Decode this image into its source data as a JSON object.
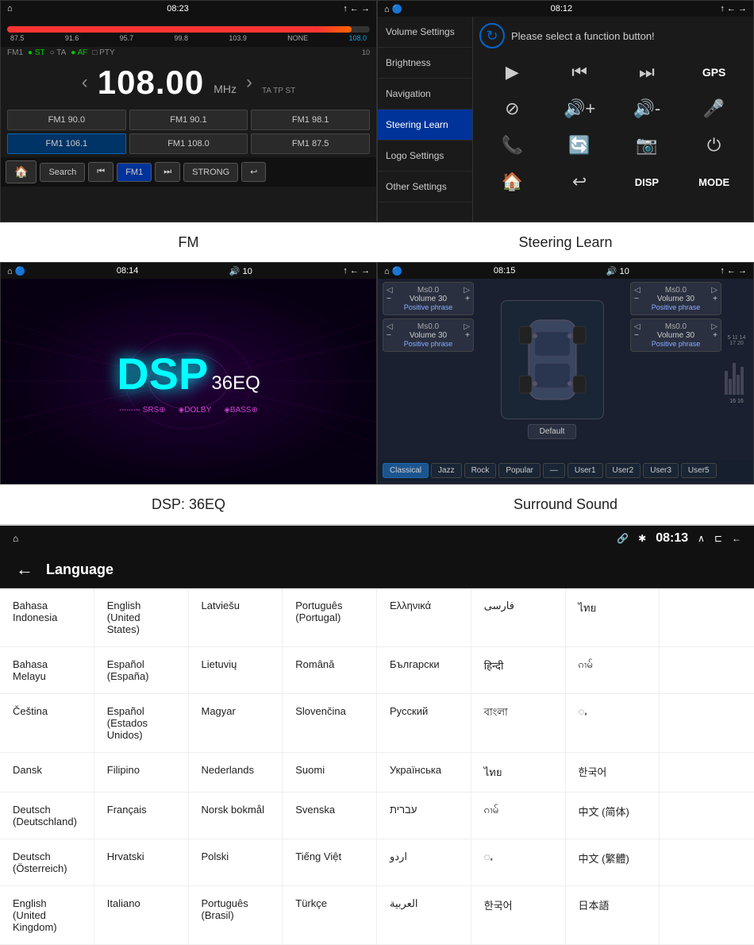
{
  "fm": {
    "statusbar": {
      "left": "⌂",
      "time": "08:23",
      "right": "↑ ← →"
    },
    "freq_markers": [
      "87.5",
      "91.6",
      "95.7",
      "99.8",
      "103.9",
      "NONE",
      "108.0"
    ],
    "freq_labels": [
      "FM1",
      "ST",
      "TA",
      "AF",
      "PTY"
    ],
    "freq_big": "108.00",
    "freq_unit": "MHz",
    "freq_tags": "TA  TP  ST",
    "presets": [
      "FM1 90.0",
      "FM1 90.1",
      "FM1 98.1",
      "FM1 106.1",
      "FM1 108.0",
      "FM1 87.5"
    ],
    "bottom_btns": [
      "🏠",
      "Search",
      "⏮",
      "FM1",
      "⏭",
      "STRONG",
      "↩"
    ],
    "caption": "FM"
  },
  "steering": {
    "statusbar": {
      "left": "⌂  🔵  🔷",
      "time": "08:12",
      "right": "↑ ← →"
    },
    "msg": "Please select a function button!",
    "menu_items": [
      "Volume Settings",
      "Brightness",
      "Navigation",
      "Steering Learn",
      "Logo Settings",
      "Other Settings"
    ],
    "active_menu": "Steering Learn",
    "icons": [
      "▶",
      "⏮",
      "⏭",
      "GPS",
      "⊘",
      "🔊+",
      "🔊-",
      "🎤",
      "📞",
      "🔄",
      "📷",
      "⏻",
      "🏠",
      "↩",
      "DISP",
      "MODE"
    ],
    "caption": "Steering Learn"
  },
  "dsp": {
    "statusbar": {
      "left": "⌂  🔵  🔷",
      "time": "08:14",
      "vol": "🔊  10",
      "right": "↑ ← →"
    },
    "title": "DSP",
    "subtitle": "36EQ",
    "tags": [
      "𝌀𝌀𝌀 SRS⊕",
      "◈DOLBY",
      "◈BASS⊕"
    ],
    "caption": "DSP: 36EQ"
  },
  "surround": {
    "statusbar": {
      "left": "⌂  🔵  🔷",
      "time": "08:15",
      "vol": "🔊  10",
      "right": "↑ ← →"
    },
    "blocks_left": [
      {
        "label": "Ms0.0",
        "vol": "Volume 30",
        "phrase": "Positive phrase"
      },
      {
        "label": "Ms0.0",
        "vol": "Volume 30",
        "phrase": "Positive phrase"
      }
    ],
    "blocks_right": [
      {
        "label": "Ms0.0",
        "vol": "Volume 30",
        "phrase": "Positive phrase"
      },
      {
        "label": "Ms0.0",
        "vol": "Volume 30",
        "phrase": "Positive phrase"
      }
    ],
    "default_btn": "Default",
    "eq_tabs": [
      "Classical",
      "Jazz",
      "Rock",
      "Popular",
      "User1",
      "User2",
      "User3",
      "User5"
    ],
    "caption": "Surround Sound"
  },
  "language": {
    "statusbar": {
      "left": "⌂",
      "center": "08:13",
      "icons": "🔗  ✱  ∧  ⊏  ←"
    },
    "title": "Language",
    "languages": [
      [
        "Bahasa Indonesia",
        "English (United States)",
        "Latviešu",
        "Português (Portugal)",
        "Ελληνικά",
        "فارسی",
        "ไทย",
        ""
      ],
      [
        "Bahasa Melayu",
        "Español (España)",
        "Lietuvių",
        "Română",
        "Български",
        "हिन्दी",
        "ၵၢမ်",
        ""
      ],
      [
        "Čeština",
        "Español (Estados Unidos)",
        "Magyar",
        "Slovenčina",
        "Русский",
        "বাংলা",
        "ꩻ",
        ""
      ],
      [
        "Dansk",
        "Filipino",
        "Nederlands",
        "Suomi",
        "Українська",
        "ไทย",
        "한국어",
        ""
      ],
      [
        "Deutsch (Deutschland)",
        "Français",
        "Norsk bokmål",
        "Svenska",
        "עברית",
        "ၵၢမ်",
        "中文 (简体)",
        ""
      ],
      [
        "Deutsch (Österreich)",
        "Hrvatski",
        "Polski",
        "Tiếng Việt",
        "اردو",
        "ꩻ",
        "中文 (繁體)",
        ""
      ],
      [
        "English (United Kingdom)",
        "Italiano",
        "Português (Brasil)",
        "Türkçe",
        "العربية",
        "한국어",
        "日本語",
        ""
      ]
    ]
  }
}
